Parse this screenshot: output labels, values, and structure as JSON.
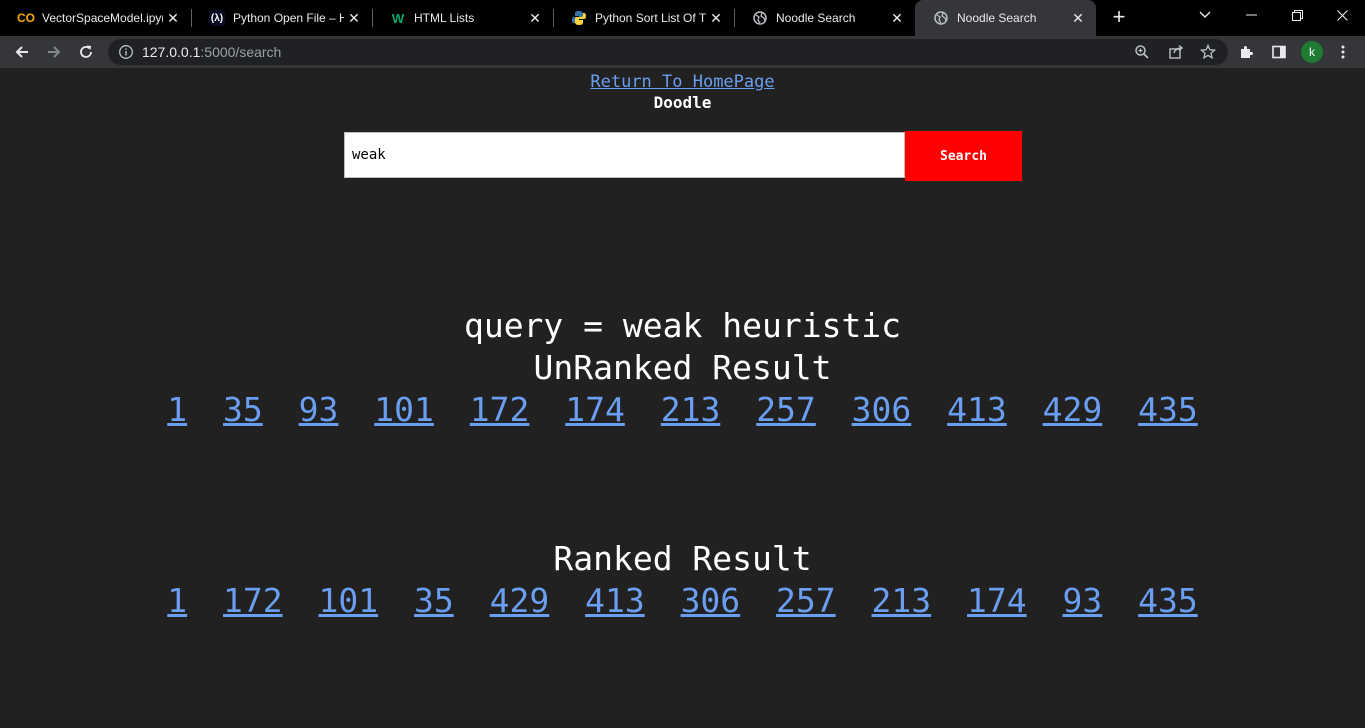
{
  "browser": {
    "tabs": [
      {
        "title": "VectorSpaceModel.ipynb",
        "icon": "colab-icon",
        "active": false
      },
      {
        "title": "Python Open File – How to Read",
        "icon": "freecodecamp-icon",
        "active": false
      },
      {
        "title": "HTML Lists",
        "icon": "w3schools-icon",
        "active": false
      },
      {
        "title": "Python Sort List Of Tuples",
        "icon": "python-icon",
        "active": false
      },
      {
        "title": "Noodle Search",
        "icon": "globe-icon",
        "active": false
      },
      {
        "title": "Noodle Search",
        "icon": "globe-icon",
        "active": true
      }
    ],
    "url_host": "127.0.0.1",
    "url_path": ":5000/search",
    "profile_initial": "k"
  },
  "page": {
    "home_link": "Return To HomePage",
    "brand": "Doodle",
    "search_value": "weak",
    "search_button": "Search",
    "query_line": "query = weak heuristic",
    "unranked_title": "UnRanked Result",
    "unranked": [
      "1",
      "35",
      "93",
      "101",
      "172",
      "174",
      "213",
      "257",
      "306",
      "413",
      "429",
      "435"
    ],
    "ranked_title": "Ranked Result",
    "ranked": [
      "1",
      "172",
      "101",
      "35",
      "429",
      "413",
      "306",
      "257",
      "213",
      "174",
      "93",
      "435"
    ]
  }
}
